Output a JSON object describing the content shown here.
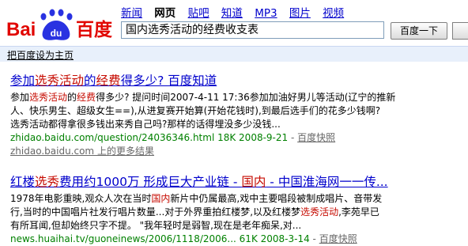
{
  "logo": {
    "text_left": "Bai",
    "text_paw": "du",
    "text_right": "百度",
    "color_red": "#e10601",
    "color_blue": "#2932e1"
  },
  "nav": {
    "items": [
      {
        "label": "新闻",
        "current": false
      },
      {
        "label": "网页",
        "current": true
      },
      {
        "label": "贴吧",
        "current": false
      },
      {
        "label": "知道",
        "current": false
      },
      {
        "label": "MP3",
        "current": false
      },
      {
        "label": "图片",
        "current": false
      },
      {
        "label": "视频",
        "current": false
      }
    ]
  },
  "search": {
    "query": "国内选秀活动的经费收支表",
    "button_label": "百度一下"
  },
  "set_home_label": "把百度设为主页",
  "results": [
    {
      "title_parts": [
        {
          "text": "参加",
          "hl": false
        },
        {
          "text": "选秀活动",
          "hl": true
        },
        {
          "text": "的",
          "hl": false
        },
        {
          "text": "经费",
          "hl": true
        },
        {
          "text": "得多少?  百度知道",
          "hl": false
        }
      ],
      "desc_lines": [
        [
          {
            "text": "参加",
            "hl": false
          },
          {
            "text": "选秀活动",
            "hl": true
          },
          {
            "text": "的",
            "hl": false
          },
          {
            "text": "经费",
            "hl": true
          },
          {
            "text": "得多少? 提问时间2007-4-11 17:36参加加油好男儿等活动(辽宁的推新",
            "hl": false
          }
        ],
        [
          {
            "text": "人、快乐男生、超级女生==),从进复赛开始算(开始花钱时),到最后选手们的花多少钱啊?",
            "hl": false
          }
        ],
        [
          {
            "text": "选秀活动都得拿很多钱出来秀自己吗?那样的话得埋没多少没钱...",
            "hl": false
          }
        ]
      ],
      "url_text": "zhidao.baidu.com/question/24036346.html 18K 2008-9-21",
      "sep": " - ",
      "cache_label": "百度快照",
      "more_text": "zhidao.baidu.com 上的更多结果"
    },
    {
      "title_parts": [
        {
          "text": "红楼",
          "hl": false
        },
        {
          "text": "选秀",
          "hl": true
        },
        {
          "text": "费用约1000万  形成巨大产业链 - ",
          "hl": false
        },
        {
          "text": "国内",
          "hl": true
        },
        {
          "text": " - 中国淮海网一一传...",
          "hl": false
        }
      ],
      "desc_lines": [
        [
          {
            "text": "1978年电影重映,观众人次在当时",
            "hl": false
          },
          {
            "text": "国内",
            "hl": true
          },
          {
            "text": "新片中仍属最高,戏中主要唱段被制成唱片、音带发",
            "hl": false
          }
        ],
        [
          {
            "text": "行,当时的中国唱片社发行唱片数量...对于外界重拍红楼梦,以及红楼梦",
            "hl": false
          },
          {
            "text": "选秀活动",
            "hl": true
          },
          {
            "text": ",李苑早已",
            "hl": false
          }
        ],
        [
          {
            "text": "有所耳闻,但却始终只字不提。 \"我年轻时是弱智,现在是老年痴呆,对...",
            "hl": false
          }
        ]
      ],
      "url_text": "news.huaihai.tv/guoneinews/2006/1118/2006... 61K 2008-3-14",
      "sep": " - ",
      "cache_label": "百度快照"
    }
  ]
}
